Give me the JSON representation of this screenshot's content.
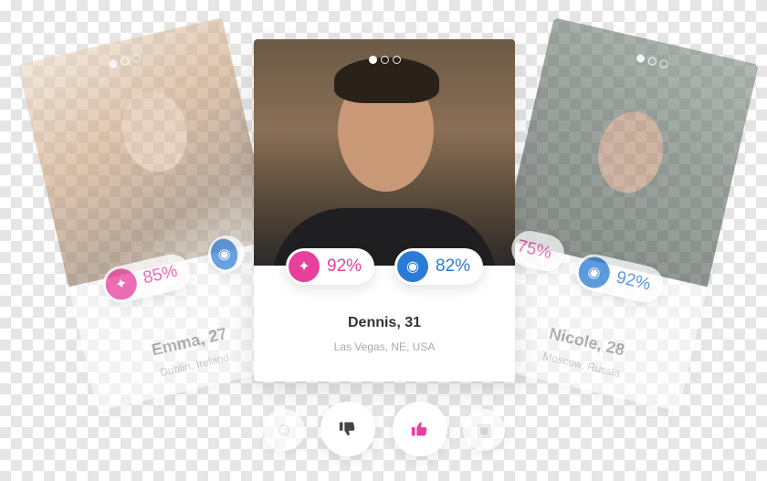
{
  "cards": {
    "left": {
      "name": "Emma, 27",
      "location": "Dublin, Ireland",
      "dna_pct": "85%",
      "mind_pct": ""
    },
    "center": {
      "name": "Dennis, 31",
      "location": "Las Vegas, NE, USA",
      "dna_pct": "92%",
      "mind_pct": "82%"
    },
    "right": {
      "name": "Nicole, 28",
      "location": "Moscow, Russia",
      "dna_pct": "75%",
      "mind_pct": "92%"
    }
  },
  "icons": {
    "dna": "dna-icon",
    "mind": "brain-head-icon",
    "neutral": "neutral-face-icon",
    "dislike": "thumbs-down-icon",
    "like": "thumbs-up-icon",
    "chat": "chat-bubble-icon"
  },
  "colors": {
    "pink": "#e83e9c",
    "blue": "#2a7bd5"
  }
}
